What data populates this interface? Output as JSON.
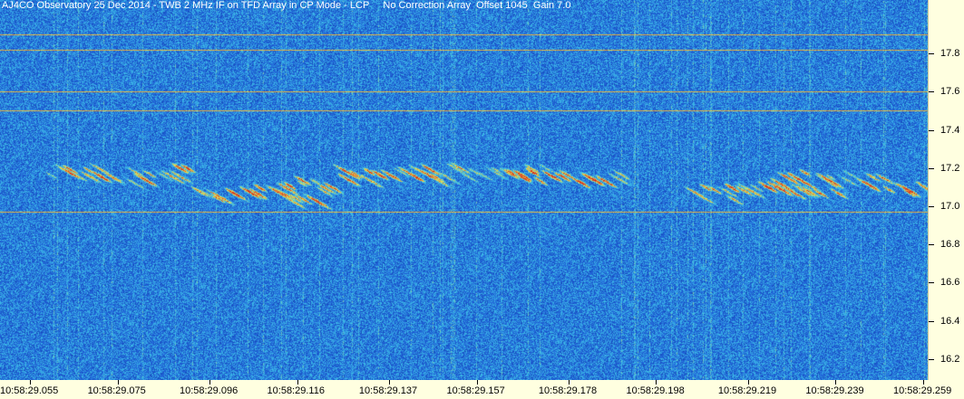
{
  "chart_data": {
    "type": "heatmap",
    "title": "AJ4CO Observatory 25 Dec 2014 - TWB 2 MHz IF on TFD Array in CP Mode - LCP     No Correction Array  Offset 1045  Gain 7.0",
    "xlabel": "",
    "ylabel": "",
    "x_ticks": [
      "10:58:29.055",
      "10:58:29.075",
      "10:58:29.096",
      "10:58:29.116",
      "10:58:29.137",
      "10:58:29.157",
      "10:58:29.178",
      "10:58:29.198",
      "10:58:29.219",
      "10:58:29.239",
      "10:58:29.259"
    ],
    "y_ticks": [
      17.8,
      17.6,
      17.4,
      17.2,
      17.0,
      16.8,
      16.6,
      16.4,
      16.2
    ],
    "ylim": [
      16.09,
      18.08
    ],
    "colormap": [
      "#0a2f8c",
      "#1f5fd8",
      "#3ec0e8",
      "#e8e050",
      "#e07030",
      "#d02020"
    ],
    "interference_lines_mhz": [
      17.9,
      17.82,
      17.6,
      17.5,
      16.97
    ],
    "bursts": [
      {
        "time_start": "10:58:29.057",
        "time_end": "10:58:29.068",
        "freq_mhz": 17.17
      },
      {
        "time_start": "10:58:29.066",
        "time_end": "10:58:29.090",
        "freq_mhz": 17.16
      },
      {
        "time_start": "10:58:29.090",
        "time_end": "10:58:29.120",
        "freq_mhz": 17.05
      },
      {
        "time_start": "10:58:29.108",
        "time_end": "10:58:29.122",
        "freq_mhz": 17.1
      },
      {
        "time_start": "10:58:29.122",
        "time_end": "10:58:29.145",
        "freq_mhz": 17.16
      },
      {
        "time_start": "10:58:29.140",
        "time_end": "10:58:29.170",
        "freq_mhz": 17.17
      },
      {
        "time_start": "10:58:29.165",
        "time_end": "10:58:29.190",
        "freq_mhz": 17.14
      },
      {
        "time_start": "10:58:29.203",
        "time_end": "10:58:29.218",
        "freq_mhz": 17.05
      },
      {
        "time_start": "10:58:29.212",
        "time_end": "10:58:29.238",
        "freq_mhz": 17.08
      },
      {
        "time_start": "10:58:29.222",
        "time_end": "10:58:29.248",
        "freq_mhz": 17.14
      },
      {
        "time_start": "10:58:29.248",
        "time_end": "10:58:29.262",
        "freq_mhz": 17.08
      }
    ]
  }
}
